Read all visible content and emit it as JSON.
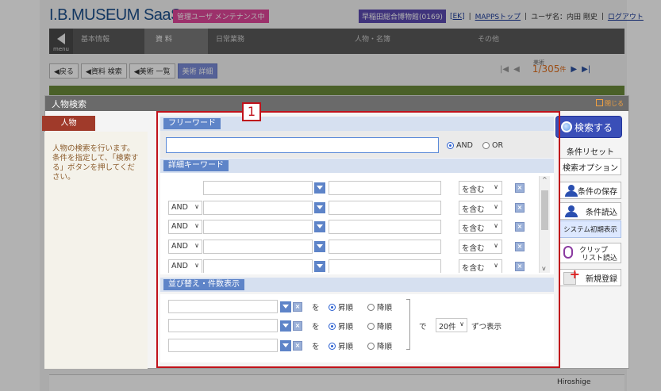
{
  "app": {
    "logo": "I.B.MUSEUM SaaS",
    "maintenance_badge": "管理ユーザ メンテナンス中",
    "museum_badge": "早稲田総合博物館(0169)",
    "ek_link": "[EK]",
    "mapps_link": "MAPPSトップ",
    "user_label": "ユーザ名：内田 剛史",
    "logout_link": "ログアウト",
    "separator": "|"
  },
  "navbar": {
    "menu_label": "menu",
    "items": [
      {
        "label": "基本情報"
      },
      {
        "label": "資 料"
      },
      {
        "label": "日常業務"
      },
      {
        "label": "人物・名簿"
      },
      {
        "label": "その他"
      }
    ]
  },
  "breadcrumbs": [
    {
      "label": "◀戻る"
    },
    {
      "label": "◀資料 検索"
    },
    {
      "label": "◀美術 一覧"
    },
    {
      "label": "美術 詳細"
    }
  ],
  "pager": {
    "label": "美術",
    "current": "1",
    "total": "/305",
    "unit": "件"
  },
  "bottom_row": {
    "text": "Hiroshige"
  },
  "dialog": {
    "title": "人物検索",
    "close_label": "閉じる",
    "tab_label": "人物",
    "help_text": "人物の検索を行います。条件を指定して、「検索する」ボタンを押してください。",
    "badge_number": "1",
    "free_word": {
      "section_label": "フリーワード",
      "value": "",
      "and_label": "AND",
      "or_label": "OR",
      "selected": "AND"
    },
    "detail": {
      "section_label": "詳細キーワード",
      "rows": [
        {
          "logic": "",
          "condition": "を含む"
        },
        {
          "logic": "AND",
          "condition": "を含む"
        },
        {
          "logic": "AND",
          "condition": "を含む"
        },
        {
          "logic": "AND",
          "condition": "を含む"
        },
        {
          "logic": "AND",
          "condition": "を含む"
        }
      ]
    },
    "sort": {
      "section_label": "並び替え・件数表示",
      "wo_label": "を",
      "asc_label": "昇順",
      "desc_label": "降順",
      "de_label": "で",
      "count_value": "20件",
      "per_label": "ずつ表示"
    },
    "buttons": {
      "search": "検索する",
      "reset": "条件リセット",
      "options": "検索オプション",
      "save": "条件の保存",
      "load": "条件読込",
      "system_default": "システム初期表示",
      "clip_line1": "クリップ",
      "clip_line2": "リスト読込",
      "new": "新規登録"
    }
  }
}
